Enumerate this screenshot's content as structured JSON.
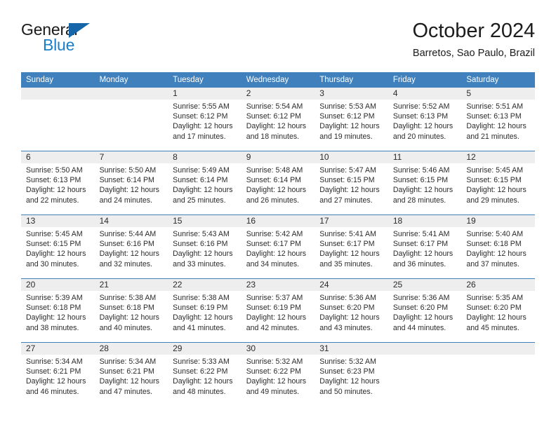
{
  "brand": {
    "word1": "General",
    "word2": "Blue",
    "triangle_color": "#1565a8",
    "word2_color": "#1a7fc9"
  },
  "header": {
    "title": "October 2024",
    "subtitle": "Barretos, Sao Paulo, Brazil",
    "accent_color": "#3f80bd",
    "band_color": "#eeeeee"
  },
  "calendar": {
    "weekday_headers": [
      "Sunday",
      "Monday",
      "Tuesday",
      "Wednesday",
      "Thursday",
      "Friday",
      "Saturday"
    ],
    "labels": {
      "sunrise": "Sunrise:",
      "sunset": "Sunset:",
      "daylight": "Daylight:"
    },
    "weeks": [
      [
        {
          "day": "",
          "sunrise": "",
          "sunset": "",
          "daylight": ""
        },
        {
          "day": "",
          "sunrise": "",
          "sunset": "",
          "daylight": ""
        },
        {
          "day": "1",
          "sunrise": "Sunrise: 5:55 AM",
          "sunset": "Sunset: 6:12 PM",
          "daylight": "Daylight: 12 hours and 17 minutes."
        },
        {
          "day": "2",
          "sunrise": "Sunrise: 5:54 AM",
          "sunset": "Sunset: 6:12 PM",
          "daylight": "Daylight: 12 hours and 18 minutes."
        },
        {
          "day": "3",
          "sunrise": "Sunrise: 5:53 AM",
          "sunset": "Sunset: 6:12 PM",
          "daylight": "Daylight: 12 hours and 19 minutes."
        },
        {
          "day": "4",
          "sunrise": "Sunrise: 5:52 AM",
          "sunset": "Sunset: 6:13 PM",
          "daylight": "Daylight: 12 hours and 20 minutes."
        },
        {
          "day": "5",
          "sunrise": "Sunrise: 5:51 AM",
          "sunset": "Sunset: 6:13 PM",
          "daylight": "Daylight: 12 hours and 21 minutes."
        }
      ],
      [
        {
          "day": "6",
          "sunrise": "Sunrise: 5:50 AM",
          "sunset": "Sunset: 6:13 PM",
          "daylight": "Daylight: 12 hours and 22 minutes."
        },
        {
          "day": "7",
          "sunrise": "Sunrise: 5:50 AM",
          "sunset": "Sunset: 6:14 PM",
          "daylight": "Daylight: 12 hours and 24 minutes."
        },
        {
          "day": "8",
          "sunrise": "Sunrise: 5:49 AM",
          "sunset": "Sunset: 6:14 PM",
          "daylight": "Daylight: 12 hours and 25 minutes."
        },
        {
          "day": "9",
          "sunrise": "Sunrise: 5:48 AM",
          "sunset": "Sunset: 6:14 PM",
          "daylight": "Daylight: 12 hours and 26 minutes."
        },
        {
          "day": "10",
          "sunrise": "Sunrise: 5:47 AM",
          "sunset": "Sunset: 6:15 PM",
          "daylight": "Daylight: 12 hours and 27 minutes."
        },
        {
          "day": "11",
          "sunrise": "Sunrise: 5:46 AM",
          "sunset": "Sunset: 6:15 PM",
          "daylight": "Daylight: 12 hours and 28 minutes."
        },
        {
          "day": "12",
          "sunrise": "Sunrise: 5:45 AM",
          "sunset": "Sunset: 6:15 PM",
          "daylight": "Daylight: 12 hours and 29 minutes."
        }
      ],
      [
        {
          "day": "13",
          "sunrise": "Sunrise: 5:45 AM",
          "sunset": "Sunset: 6:15 PM",
          "daylight": "Daylight: 12 hours and 30 minutes."
        },
        {
          "day": "14",
          "sunrise": "Sunrise: 5:44 AM",
          "sunset": "Sunset: 6:16 PM",
          "daylight": "Daylight: 12 hours and 32 minutes."
        },
        {
          "day": "15",
          "sunrise": "Sunrise: 5:43 AM",
          "sunset": "Sunset: 6:16 PM",
          "daylight": "Daylight: 12 hours and 33 minutes."
        },
        {
          "day": "16",
          "sunrise": "Sunrise: 5:42 AM",
          "sunset": "Sunset: 6:17 PM",
          "daylight": "Daylight: 12 hours and 34 minutes."
        },
        {
          "day": "17",
          "sunrise": "Sunrise: 5:41 AM",
          "sunset": "Sunset: 6:17 PM",
          "daylight": "Daylight: 12 hours and 35 minutes."
        },
        {
          "day": "18",
          "sunrise": "Sunrise: 5:41 AM",
          "sunset": "Sunset: 6:17 PM",
          "daylight": "Daylight: 12 hours and 36 minutes."
        },
        {
          "day": "19",
          "sunrise": "Sunrise: 5:40 AM",
          "sunset": "Sunset: 6:18 PM",
          "daylight": "Daylight: 12 hours and 37 minutes."
        }
      ],
      [
        {
          "day": "20",
          "sunrise": "Sunrise: 5:39 AM",
          "sunset": "Sunset: 6:18 PM",
          "daylight": "Daylight: 12 hours and 38 minutes."
        },
        {
          "day": "21",
          "sunrise": "Sunrise: 5:38 AM",
          "sunset": "Sunset: 6:18 PM",
          "daylight": "Daylight: 12 hours and 40 minutes."
        },
        {
          "day": "22",
          "sunrise": "Sunrise: 5:38 AM",
          "sunset": "Sunset: 6:19 PM",
          "daylight": "Daylight: 12 hours and 41 minutes."
        },
        {
          "day": "23",
          "sunrise": "Sunrise: 5:37 AM",
          "sunset": "Sunset: 6:19 PM",
          "daylight": "Daylight: 12 hours and 42 minutes."
        },
        {
          "day": "24",
          "sunrise": "Sunrise: 5:36 AM",
          "sunset": "Sunset: 6:20 PM",
          "daylight": "Daylight: 12 hours and 43 minutes."
        },
        {
          "day": "25",
          "sunrise": "Sunrise: 5:36 AM",
          "sunset": "Sunset: 6:20 PM",
          "daylight": "Daylight: 12 hours and 44 minutes."
        },
        {
          "day": "26",
          "sunrise": "Sunrise: 5:35 AM",
          "sunset": "Sunset: 6:20 PM",
          "daylight": "Daylight: 12 hours and 45 minutes."
        }
      ],
      [
        {
          "day": "27",
          "sunrise": "Sunrise: 5:34 AM",
          "sunset": "Sunset: 6:21 PM",
          "daylight": "Daylight: 12 hours and 46 minutes."
        },
        {
          "day": "28",
          "sunrise": "Sunrise: 5:34 AM",
          "sunset": "Sunset: 6:21 PM",
          "daylight": "Daylight: 12 hours and 47 minutes."
        },
        {
          "day": "29",
          "sunrise": "Sunrise: 5:33 AM",
          "sunset": "Sunset: 6:22 PM",
          "daylight": "Daylight: 12 hours and 48 minutes."
        },
        {
          "day": "30",
          "sunrise": "Sunrise: 5:32 AM",
          "sunset": "Sunset: 6:22 PM",
          "daylight": "Daylight: 12 hours and 49 minutes."
        },
        {
          "day": "31",
          "sunrise": "Sunrise: 5:32 AM",
          "sunset": "Sunset: 6:23 PM",
          "daylight": "Daylight: 12 hours and 50 minutes."
        },
        {
          "day": "",
          "sunrise": "",
          "sunset": "",
          "daylight": ""
        },
        {
          "day": "",
          "sunrise": "",
          "sunset": "",
          "daylight": ""
        }
      ]
    ]
  }
}
